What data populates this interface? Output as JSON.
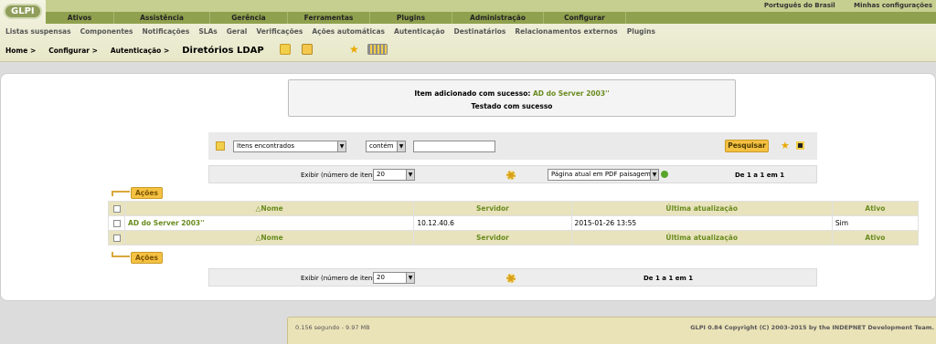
{
  "app": {
    "logo_text": "GLPI"
  },
  "toplinks": {
    "language": "Português do Brasil",
    "settings": "Minhas configurações"
  },
  "menu": [
    "Ativos",
    "Assistência",
    "Gerência",
    "Ferramentas",
    "Plugins",
    "Administração",
    "Configurar"
  ],
  "submenu": [
    "Listas suspensas",
    "Componentes",
    "Notificações",
    "SLAs",
    "Geral",
    "Verificações",
    "Ações automáticas",
    "Autenticação",
    "Destinatários",
    "Relacionamentos externos",
    "Plugins"
  ],
  "breadcrumb": {
    "home": "Home >",
    "config": "Configurar >",
    "auth": "Autenticação >",
    "title": "Diretórios LDAP"
  },
  "message": {
    "prefix": "Item adicionado com sucesso:",
    "item": "AD do Server 2003''",
    "line2": "Testado com sucesso"
  },
  "search": {
    "field": "Itens encontrados",
    "operator": "contém",
    "value": "",
    "button": "Pesquisar"
  },
  "pager": {
    "label": "Exibir (número de itens)",
    "count": "20",
    "export": "Página atual em PDF paisagem",
    "range": "De 1 a 1 em 1"
  },
  "actions_label": "Ações",
  "table": {
    "headers": [
      "Nome",
      "Servidor",
      "Última atualização",
      "Ativo"
    ],
    "rows": [
      {
        "name": "AD do Server 2003''",
        "server": "10.12.40.6",
        "updated": "2015-01-26 13:55",
        "active": "Sim"
      }
    ]
  },
  "footer": {
    "timing": "0.156 segundo - 9.97 MB",
    "copyright": "GLPI 0.84 Copyright (C) 2003-2015 by the INDEPNET Development Team."
  },
  "colors": {
    "menu_bg": "#8fa14e",
    "accent_green": "#6a8b1f",
    "button_yellow": "#f5c142"
  }
}
